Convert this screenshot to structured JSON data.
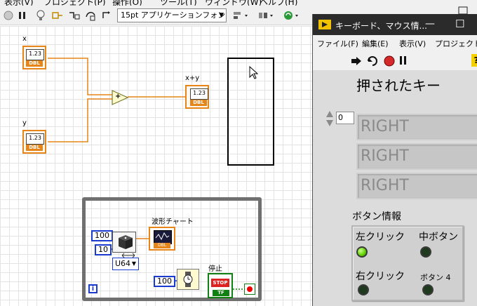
{
  "menubar": {
    "items": [
      "表示(V)",
      "プロジェクト(P)",
      "操作(O)",
      "ツール(T)",
      "ウィンドウ(W)",
      "ヘルプ(H)"
    ]
  },
  "toolbar": {
    "font_select": "15pt アプリケーションフォント",
    "icons": [
      "run-stop-icon",
      "pause-icon",
      "highlight-execution-icon",
      "retain-wire-values-icon",
      "step-into-icon",
      "align-icon",
      "distribute-icon",
      "reorder-icon"
    ]
  },
  "diagram": {
    "x_label": "x",
    "y_label": "y",
    "sum_label": "x+y",
    "terminal_value": "1.23",
    "terminal_type": "DBL",
    "add_symbol": "+",
    "const_100": "100",
    "const_10": "10",
    "u64_label": "U64",
    "waveform_label": "波形チャート",
    "stop_label": "停止",
    "stop_text": "STOP",
    "tf_text": "TF",
    "wait_const": "100",
    "info_icon": "i",
    "waveform_bottom": "DBL"
  },
  "frontpanel": {
    "title": "キーボード、マウス情...",
    "minimize": "—",
    "maximize": "☐",
    "menus": [
      "ファイル(F)",
      "編集(E)",
      "表示(V)",
      "プロジェクト(P"
    ],
    "heading": "押されたキー",
    "index_value": "0",
    "keys": [
      "RIGHT",
      "RIGHT",
      "RIGHT"
    ],
    "button_info_label": "ボタン情報",
    "buttons": [
      {
        "label": "左クリック",
        "on": true
      },
      {
        "label": "中ボタン",
        "on": false
      },
      {
        "label": "右クリック",
        "on": false
      },
      {
        "label": "ボタン 4",
        "on": false
      }
    ]
  },
  "colors": {
    "dbl_orange": "#e5851a",
    "wire_orange": "#e5851a",
    "loop_gray": "#707070",
    "const_blue": "#1a3ad0",
    "bool_green": "#108010",
    "led_on": "#5fd000"
  }
}
